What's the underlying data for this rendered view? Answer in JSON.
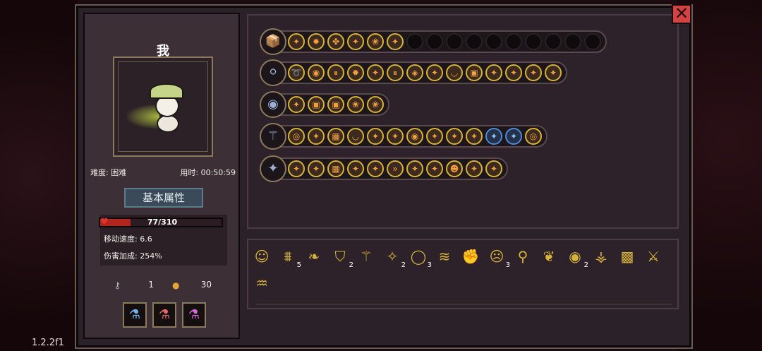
{
  "character": {
    "name": "我",
    "difficulty_label": "难度: 困难",
    "time_label": "用时: 00:50:59",
    "section_title": "基本属性",
    "hp_text": "77/310",
    "hp_fraction": 0.248,
    "move_speed": "移动速度: 6.6",
    "damage_bonus": "伤害加成: 254%",
    "keys": "1",
    "coins": "30"
  },
  "version": "1.2.2f1",
  "weapons": [
    {
      "icon": "📦",
      "slots": [
        "✦",
        "✹",
        "✤",
        "✦",
        "❀",
        "✦",
        "",
        "",
        "",
        "",
        "",
        "",
        "",
        "",
        "",
        ""
      ]
    },
    {
      "icon": "⚪",
      "slots": [
        "➰",
        "◉",
        "⏸",
        "✹",
        "✦",
        "⏸",
        "◈",
        "✦",
        "◡",
        "▣",
        "✦",
        "✦",
        "✦",
        "✦"
      ]
    },
    {
      "icon": "◉",
      "slots": [
        "✦",
        "▣",
        "▣",
        "❀",
        "❀"
      ]
    },
    {
      "icon": "⚚",
      "slots": [
        "◎",
        "✦",
        "▦",
        "◡",
        "✦",
        "✦",
        "◉",
        "✦",
        "✦",
        "✦",
        "✦",
        "✦",
        "◎"
      ]
    },
    {
      "icon": "✦",
      "slots": [
        "✦",
        "✦",
        "▦",
        "✦",
        "✦",
        "»",
        "✦",
        "✦",
        "☻",
        "✦",
        "✦"
      ]
    }
  ],
  "items": [
    {
      "icon": "☺",
      "count": ""
    },
    {
      "icon": "⩩",
      "count": "5"
    },
    {
      "icon": "❧",
      "count": ""
    },
    {
      "icon": "⛉",
      "count": "2"
    },
    {
      "icon": "⚚",
      "count": ""
    },
    {
      "icon": "✧",
      "count": "2"
    },
    {
      "icon": "◯",
      "count": "3"
    },
    {
      "icon": "≋",
      "count": ""
    },
    {
      "icon": "✊",
      "count": ""
    },
    {
      "icon": "☹",
      "count": "3"
    },
    {
      "icon": "⚲",
      "count": ""
    },
    {
      "icon": "❦",
      "count": ""
    },
    {
      "icon": "◉",
      "count": "2"
    },
    {
      "icon": "⚶",
      "count": ""
    },
    {
      "icon": "▩",
      "count": ""
    },
    {
      "icon": "⚔",
      "count": ""
    },
    {
      "icon": "♒",
      "count": ""
    }
  ]
}
